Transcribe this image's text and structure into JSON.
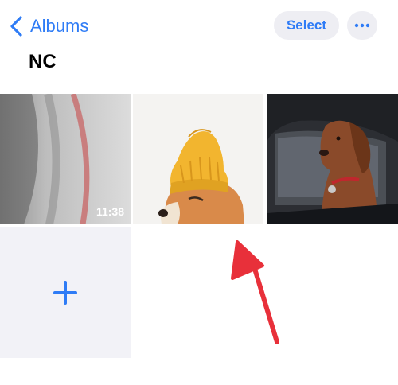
{
  "nav": {
    "back_label": "Albums",
    "select_label": "Select"
  },
  "album": {
    "title": "NC"
  },
  "grid": {
    "items": [
      {
        "kind": "video",
        "duration": "11:38"
      },
      {
        "kind": "photo"
      },
      {
        "kind": "photo"
      },
      {
        "kind": "add"
      }
    ]
  },
  "colors": {
    "accent": "#2f7cf6",
    "button_bg": "#eeeef3",
    "add_tile_bg": "#f2f2f7",
    "annotation": "#e8303a"
  },
  "icons": {
    "back": "chevron-left-icon",
    "more": "ellipsis-icon",
    "add": "plus-icon"
  }
}
